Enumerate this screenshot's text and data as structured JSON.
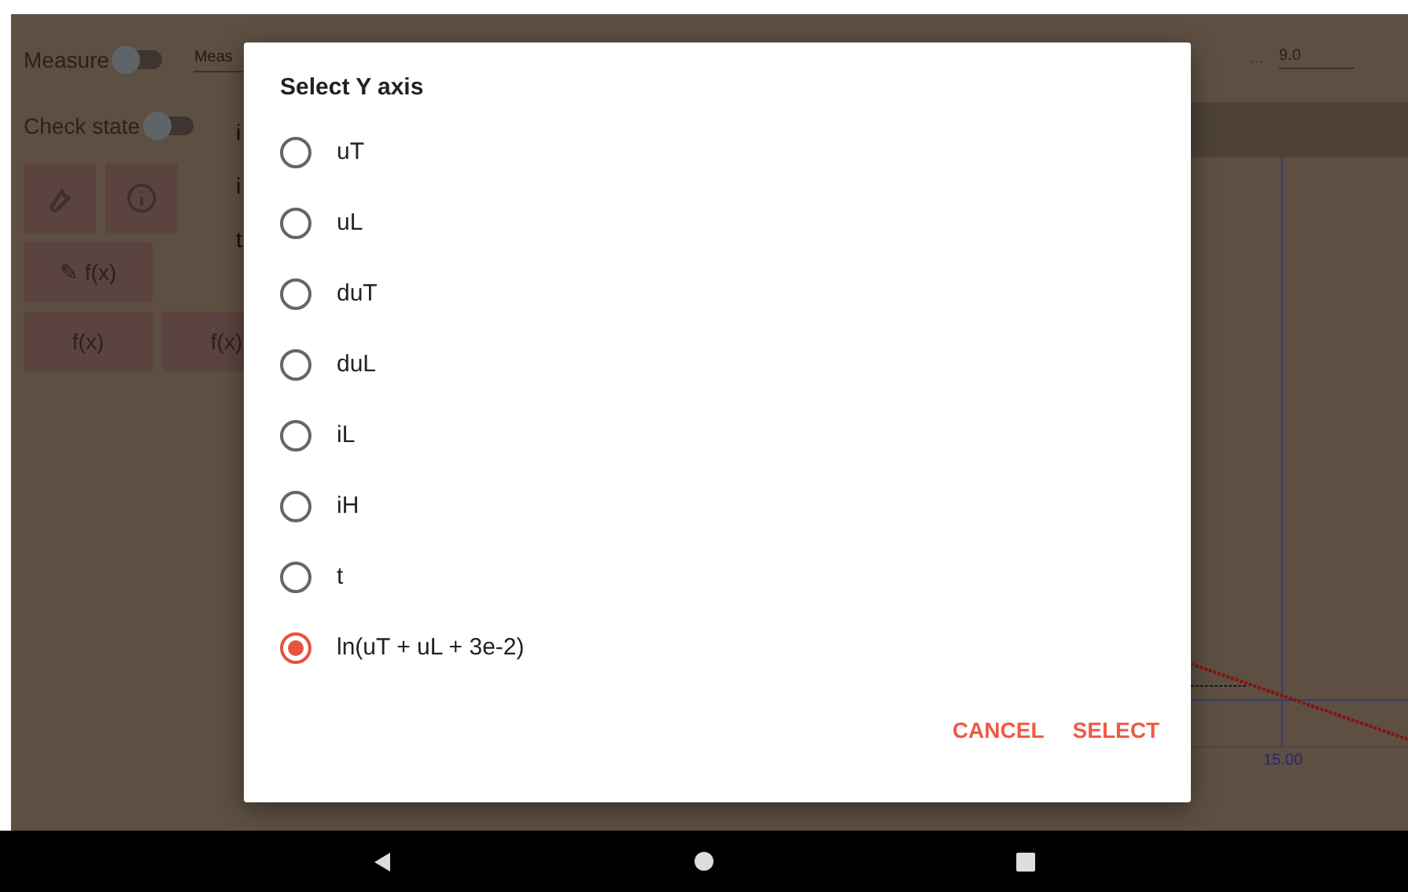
{
  "app": {
    "toggles": [
      {
        "label": "Measure",
        "on": false
      },
      {
        "label": "Check state",
        "on": false
      }
    ],
    "measure_field": {
      "placeholder": "Meas"
    },
    "side_labels": [
      "i",
      "i",
      "t"
    ],
    "formula_buttons": [
      {
        "label": "✎ f(x)"
      },
      {
        "label": "f(x)"
      },
      {
        "label": "f(x)"
      }
    ],
    "range_field": {
      "separator": "...",
      "value": "9.0"
    },
    "chart": {
      "x_tick_label": "15.00"
    }
  },
  "dialog": {
    "title": "Select Y axis",
    "options": [
      {
        "label": "uT",
        "selected": false
      },
      {
        "label": "uL",
        "selected": false
      },
      {
        "label": "duT",
        "selected": false
      },
      {
        "label": "duL",
        "selected": false
      },
      {
        "label": "iL",
        "selected": false
      },
      {
        "label": "iH",
        "selected": false
      },
      {
        "label": "t",
        "selected": false
      },
      {
        "label": "ln(uT + uL + 3e-2)",
        "selected": true
      }
    ],
    "buttons": [
      "CANCEL",
      "SELECT"
    ]
  }
}
